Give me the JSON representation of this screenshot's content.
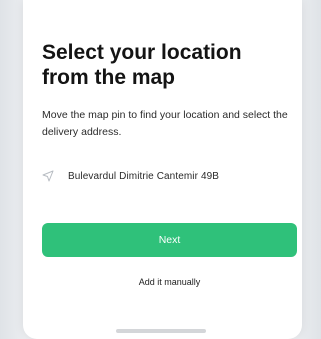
{
  "header": {
    "title": "Select your location from the map",
    "subtitle": "Move the map pin to find your location and select the delivery address."
  },
  "address": {
    "icon": "location-arrow-icon",
    "value": "Bulevardul Dimitrie Cantemir 49B"
  },
  "actions": {
    "next_label": "Next",
    "manual_label": "Add it manually"
  },
  "colors": {
    "accent": "#2fc17a",
    "background": "#ffffff",
    "text": "#141414"
  }
}
